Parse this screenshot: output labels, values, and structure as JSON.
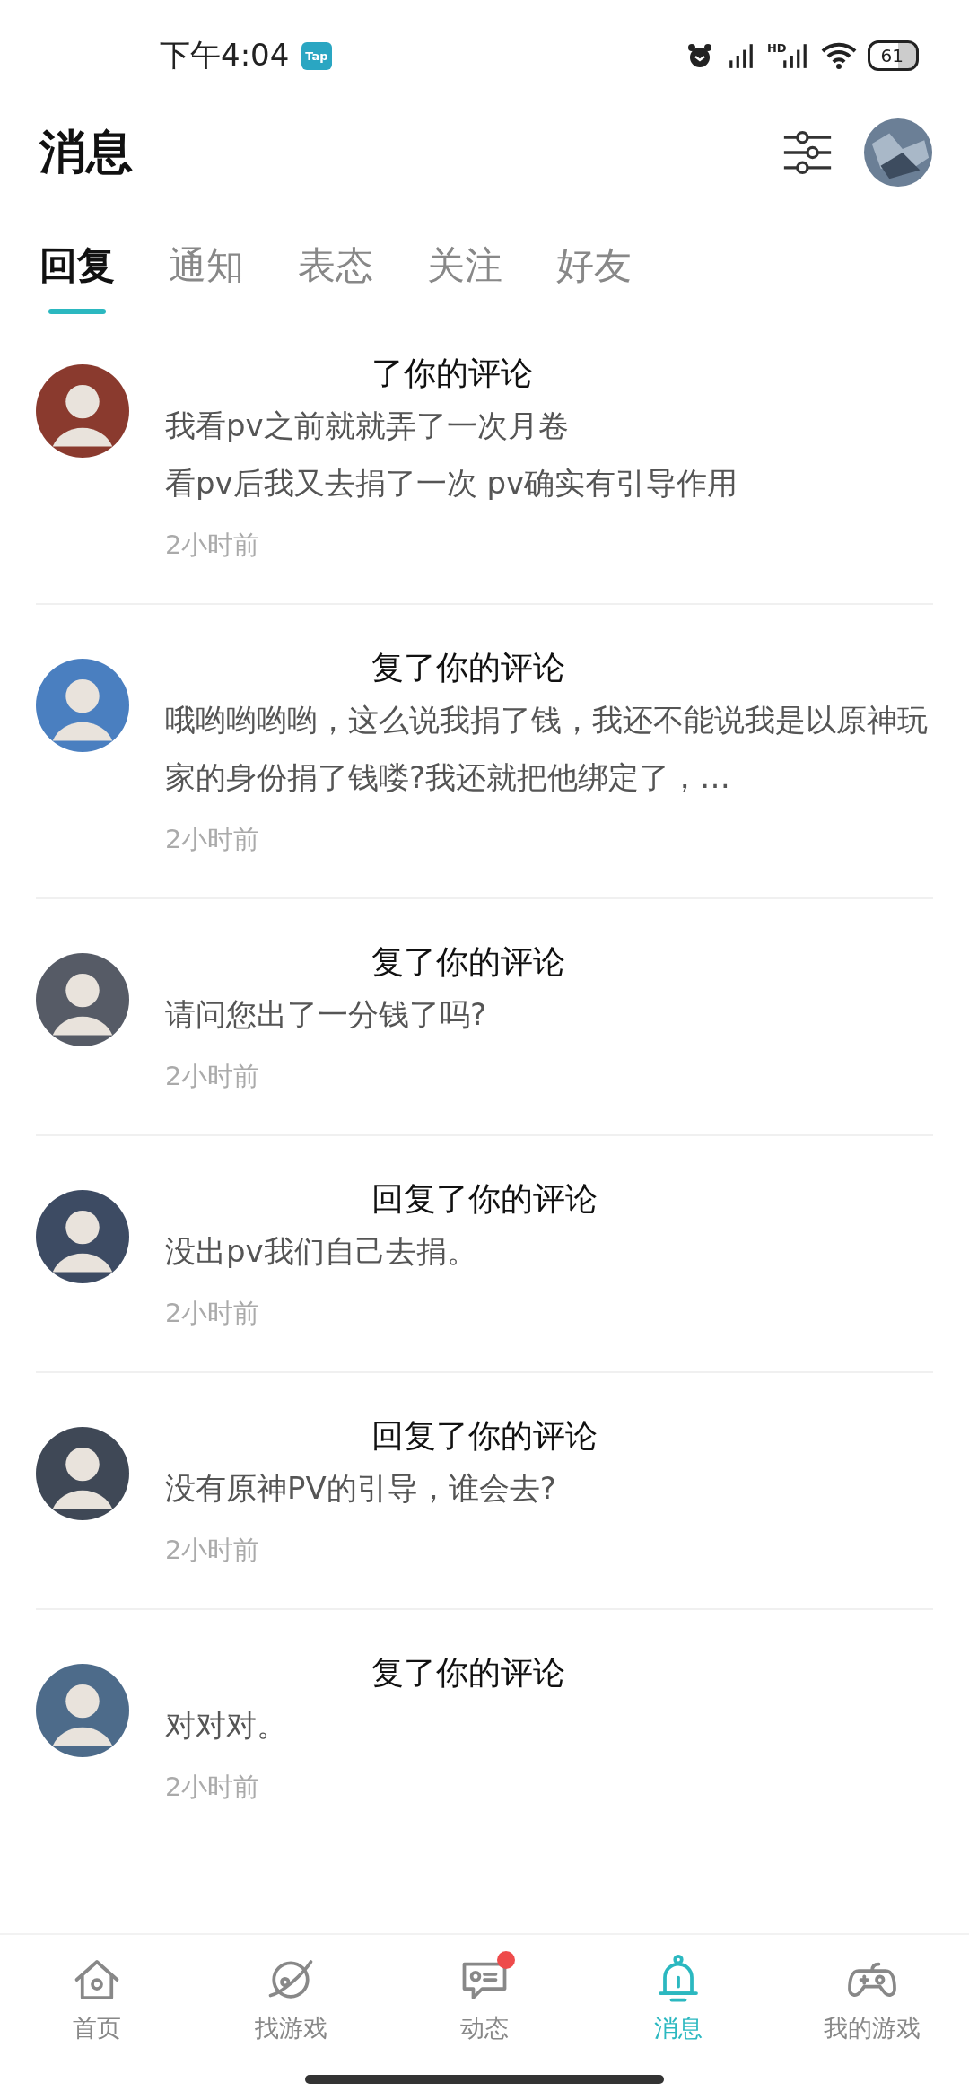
{
  "status_bar": {
    "time": "下午4:04",
    "app_badge": "Tap",
    "signal_label": "HD",
    "battery": "61"
  },
  "header": {
    "title": "消息"
  },
  "tabs": [
    {
      "label": "回复",
      "selected": true
    },
    {
      "label": "通知",
      "selected": false
    },
    {
      "label": "表态",
      "selected": false
    },
    {
      "label": "关注",
      "selected": false
    },
    {
      "label": "好友",
      "selected": false
    }
  ],
  "messages": [
    {
      "headline": "了你的评论",
      "lines": [
        "我看pv之前就就弄了一次月卷",
        "看pv后我又去捐了一次   pv确实有引导作用"
      ],
      "time": "2小时前"
    },
    {
      "headline": "复了你的评论",
      "lines": [
        "哦哟哟哟哟，这么说我捐了钱，我还不能说我是以原神玩家的身份捐了钱喽?我还就把他绑定了，…"
      ],
      "time": "2小时前"
    },
    {
      "headline": "复了你的评论",
      "lines": [
        "请问您出了一分钱了吗?"
      ],
      "time": "2小时前"
    },
    {
      "headline": "回复了你的评论",
      "lines": [
        "没出pv我们自己去捐。"
      ],
      "time": "2小时前"
    },
    {
      "headline": "回复了你的评论",
      "lines": [
        "没有原神PV的引导，谁会去?"
      ],
      "time": "2小时前"
    },
    {
      "headline": "复了你的评论",
      "lines": [
        "对对对。"
      ],
      "time": "2小时前"
    }
  ],
  "bottom_nav": [
    {
      "label": "首页",
      "selected": false,
      "badge": false
    },
    {
      "label": "找游戏",
      "selected": false,
      "badge": false
    },
    {
      "label": "动态",
      "selected": false,
      "badge": true
    },
    {
      "label": "消息",
      "selected": true,
      "badge": false
    },
    {
      "label": "我的游戏",
      "selected": false,
      "badge": false
    }
  ]
}
